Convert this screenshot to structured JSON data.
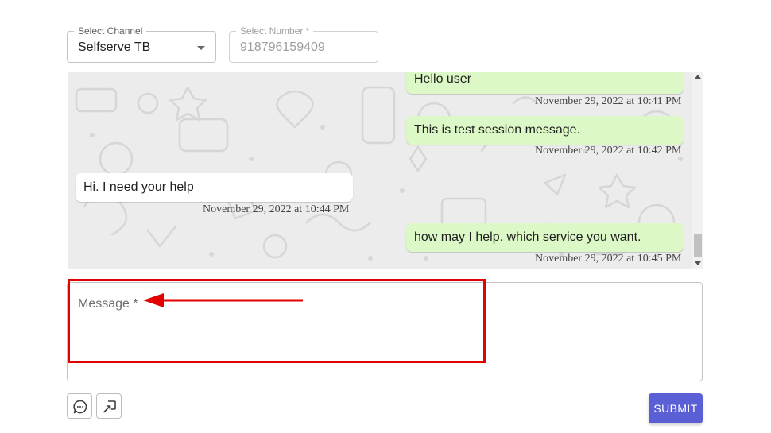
{
  "channel_select": {
    "label": "Select Channel",
    "value": "Selfserve TB"
  },
  "number_field": {
    "label": "Select Number *",
    "value": "918796159409"
  },
  "messages": [
    {
      "direction": "outgoing",
      "text": "Hello user",
      "timestamp": "November 29, 2022 at 10:41 PM"
    },
    {
      "direction": "outgoing",
      "text": "This is test session message.",
      "timestamp": "November 29, 2022 at 10:42 PM"
    },
    {
      "direction": "incoming",
      "text": "Hi. I need your help",
      "timestamp": "November 29, 2022 at 10:44 PM"
    },
    {
      "direction": "outgoing",
      "text": "how may I help. which service you want.",
      "timestamp": "November 29, 2022 at 10:45 PM"
    }
  ],
  "message_field": {
    "label": "Message *"
  },
  "buttons": {
    "emoji_icon": "chat-bubble-icon",
    "attach_icon": "attach-file-icon",
    "submit": "SUBMIT"
  },
  "colors": {
    "outgoing_bubble": "#dcf8c6",
    "incoming_bubble": "#ffffff",
    "submit": "#5a5fd6",
    "annotation": "#e30000"
  }
}
